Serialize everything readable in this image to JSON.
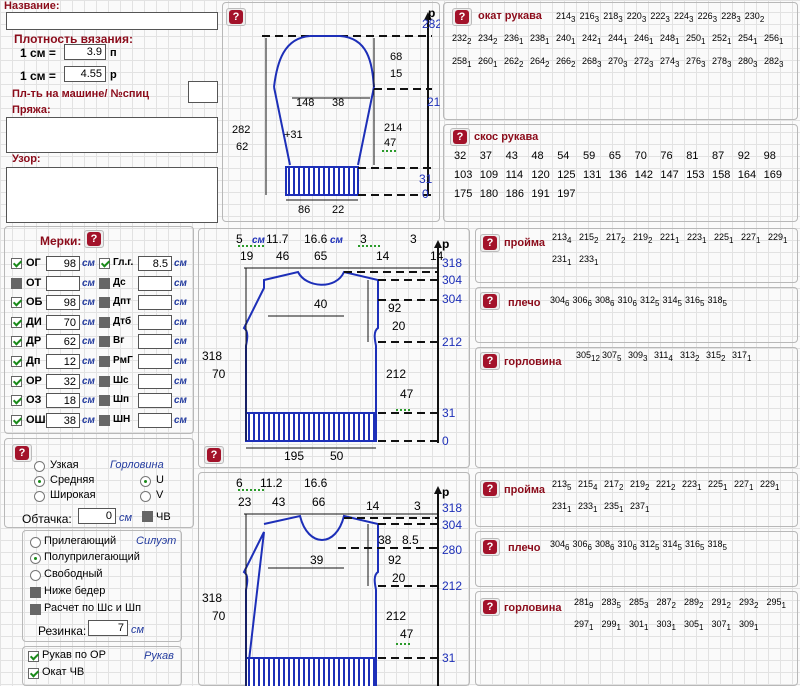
{
  "header": {
    "name_label": "Название:",
    "density_label": "Плотность вязания:",
    "cm1_label": "1 см =",
    "density_p": {
      "value": "3.9",
      "unit": "п"
    },
    "density_r": {
      "value": "4.55",
      "unit": "р"
    },
    "machine_label": "Пл-ть на машине/ №спиц",
    "yarn_label": "Пряжа:",
    "pattern_label": "Узор:"
  },
  "sleeve_diagram": {
    "top_rows": "282",
    "p": "р",
    "label_148": "148",
    "label_38": "38",
    "label_68": "68",
    "label_15": "15",
    "label_214": "214",
    "label_282": "282",
    "label_62": "62",
    "label_31": "+31",
    "label_214b": "214",
    "label_47": "47",
    "label_31b": "31",
    "label_0": "0",
    "label_86": "86",
    "label_22": "22",
    "u_p": "п",
    "u_r": "р",
    "u_cm": "см"
  },
  "okat": {
    "title": "окат рукава",
    "rows": [
      [
        [
          "214",
          "3"
        ],
        [
          "216",
          "3"
        ],
        [
          "218",
          "3"
        ],
        [
          "220",
          "3"
        ],
        [
          "222",
          "3"
        ],
        [
          "224",
          "3"
        ],
        [
          "226",
          "3"
        ],
        [
          "228",
          "3"
        ],
        [
          "230",
          "2"
        ]
      ],
      [
        [
          "232",
          "2"
        ],
        [
          "234",
          "2"
        ],
        [
          "236",
          "1"
        ],
        [
          "238",
          "1"
        ],
        [
          "240",
          "1"
        ],
        [
          "242",
          "1"
        ],
        [
          "244",
          "1"
        ],
        [
          "246",
          "1"
        ],
        [
          "248",
          "1"
        ],
        [
          "250",
          "1"
        ],
        [
          "252",
          "1"
        ],
        [
          "254",
          "1"
        ],
        [
          "256",
          "1"
        ]
      ],
      [
        [
          "258",
          "1"
        ],
        [
          "260",
          "1"
        ],
        [
          "262",
          "2"
        ],
        [
          "264",
          "2"
        ],
        [
          "266",
          "2"
        ],
        [
          "268",
          "3"
        ],
        [
          "270",
          "3"
        ],
        [
          "272",
          "3"
        ],
        [
          "274",
          "3"
        ],
        [
          "276",
          "3"
        ],
        [
          "278",
          "3"
        ],
        [
          "280",
          "3"
        ],
        [
          "282",
          "3"
        ]
      ]
    ]
  },
  "skos": {
    "title": "скос рукава",
    "rows": [
      [
        "32",
        "37",
        "43",
        "48",
        "54",
        "59",
        "65",
        "70",
        "76",
        "81",
        "87",
        "92",
        "98"
      ],
      [
        "103",
        "109",
        "114",
        "120",
        "125",
        "131",
        "136",
        "142",
        "147",
        "153",
        "158",
        "164",
        "169"
      ],
      [
        "175",
        "180",
        "186",
        "191",
        "197"
      ]
    ]
  },
  "merki": {
    "title": "Мерки:",
    "left": [
      {
        "code": "ОГ",
        "value": "98",
        "on": true
      },
      {
        "code": "ОТ",
        "value": "",
        "on": false
      },
      {
        "code": "ОБ",
        "value": "98",
        "on": true
      },
      {
        "code": "ДИ",
        "value": "70",
        "on": true
      },
      {
        "code": "ДР",
        "value": "62",
        "on": true
      },
      {
        "code": "Дп",
        "value": "12",
        "on": true
      },
      {
        "code": "ОР",
        "value": "32",
        "on": true
      },
      {
        "code": "ОЗ",
        "value": "18",
        "on": true
      },
      {
        "code": "ОШ",
        "value": "38",
        "on": true
      }
    ],
    "right": [
      {
        "code": "Гл.г.",
        "value": "8.5",
        "on": true
      },
      {
        "code": "Дс",
        "value": "",
        "on": false
      },
      {
        "code": "Дпт",
        "value": "",
        "on": false
      },
      {
        "code": "Дтб",
        "value": "",
        "on": false
      },
      {
        "code": "Вг",
        "value": "",
        "on": false
      },
      {
        "code": "РмГ",
        "value": "",
        "on": false
      },
      {
        "code": "Шс",
        "value": "",
        "on": false
      },
      {
        "code": "Шп",
        "value": "",
        "on": false
      },
      {
        "code": "ШН",
        "value": "",
        "on": false
      }
    ],
    "unit": "см"
  },
  "neck": {
    "title": "Горловина",
    "options": [
      "Узкая",
      "Средняя",
      "Широкая"
    ],
    "shape_options": [
      "U",
      "V"
    ],
    "obtachka_label": "Обтачка:",
    "obtachka_value": "0",
    "unit": "см",
    "chv_label": "ЧВ"
  },
  "silhouette": {
    "title": "Силуэт",
    "options": [
      "Прилегающий",
      "Полуприлегающий",
      "Свободный"
    ],
    "checks": [
      "Ниже бедер",
      "Расчет по Шс и Шп"
    ],
    "rezinka_label": "Резинка:",
    "rezinka_value": "7",
    "unit": "см"
  },
  "sleeve_opts": {
    "title": "Рукав",
    "checks": [
      "Рукав по ОР",
      "Окат ЧВ"
    ]
  },
  "back_diagram": {
    "top_cm": [
      "5",
      "11.7",
      "16.6",
      "3",
      "3"
    ],
    "top_p": [
      "19",
      "46",
      "65",
      "14",
      "14"
    ],
    "rows_r": [
      "318",
      "304",
      "304",
      "212",
      "31",
      "0"
    ],
    "w40": "40",
    "l318": "318",
    "l70": "70",
    "l92": "92",
    "l20": "20",
    "l212": "212",
    "l47": "47",
    "l195": "195",
    "l50": "50",
    "u_p": "п",
    "u_r": "р",
    "u_cm": "см"
  },
  "front_diagram": {
    "top_cm": [
      "6",
      "11.2",
      "16.6",
      "3"
    ],
    "top_p": [
      "23",
      "43",
      "66",
      "14"
    ],
    "rows_r": [
      "318",
      "304",
      "280",
      "212",
      "31"
    ],
    "w39": "39",
    "l318": "318",
    "l70": "70",
    "l38": "38",
    "l85": "8.5",
    "l92": "92",
    "l20": "20",
    "l212": "212",
    "l47": "47",
    "u_p": "п",
    "u_r": "р",
    "u_cm": "см"
  },
  "back_tables": {
    "proyma": {
      "title": "пройма",
      "vals": [
        [
          "213",
          "4"
        ],
        [
          "215",
          "2"
        ],
        [
          "217",
          "2"
        ],
        [
          "219",
          "2"
        ],
        [
          "221",
          "1"
        ],
        [
          "223",
          "1"
        ],
        [
          "225",
          "1"
        ],
        [
          "227",
          "1"
        ],
        [
          "229",
          "1"
        ],
        [
          "231",
          "1"
        ],
        [
          "233",
          "1"
        ]
      ]
    },
    "plecho": {
      "title": "плечо",
      "vals": [
        [
          "304",
          "6"
        ],
        [
          "306",
          "6"
        ],
        [
          "308",
          "6"
        ],
        [
          "310",
          "6"
        ],
        [
          "312",
          "5"
        ],
        [
          "314",
          "5"
        ],
        [
          "316",
          "5"
        ],
        [
          "318",
          "5"
        ]
      ]
    },
    "gorlovina": {
      "title": "горловина",
      "vals": [
        [
          "305",
          "12"
        ],
        [
          "307",
          "5"
        ],
        [
          "309",
          "3"
        ],
        [
          "311",
          "4"
        ],
        [
          "313",
          "2"
        ],
        [
          "315",
          "2"
        ],
        [
          "317",
          "1"
        ]
      ]
    }
  },
  "front_tables": {
    "proyma": {
      "title": "пройма",
      "vals": [
        [
          "213",
          "5"
        ],
        [
          "215",
          "4"
        ],
        [
          "217",
          "2"
        ],
        [
          "219",
          "2"
        ],
        [
          "221",
          "2"
        ],
        [
          "223",
          "1"
        ],
        [
          "225",
          "1"
        ],
        [
          "227",
          "1"
        ],
        [
          "229",
          "1"
        ],
        [
          "231",
          "1"
        ],
        [
          "233",
          "1"
        ],
        [
          "235",
          "1"
        ],
        [
          "237",
          "1"
        ]
      ]
    },
    "plecho": {
      "title": "плечо",
      "vals": [
        [
          "304",
          "6"
        ],
        [
          "306",
          "6"
        ],
        [
          "308",
          "6"
        ],
        [
          "310",
          "6"
        ],
        [
          "312",
          "5"
        ],
        [
          "314",
          "5"
        ],
        [
          "316",
          "5"
        ],
        [
          "318",
          "5"
        ]
      ]
    },
    "gorlovina": {
      "title": "горловина",
      "vals": [
        [
          "281",
          "9"
        ],
        [
          "283",
          "5"
        ],
        [
          "285",
          "3"
        ],
        [
          "287",
          "2"
        ],
        [
          "289",
          "2"
        ],
        [
          "291",
          "2"
        ],
        [
          "293",
          "2"
        ],
        [
          "295",
          "1"
        ],
        [
          "297",
          "1"
        ],
        [
          "299",
          "1"
        ],
        [
          "301",
          "1"
        ],
        [
          "303",
          "1"
        ],
        [
          "305",
          "1"
        ],
        [
          "307",
          "1"
        ],
        [
          "309",
          "1"
        ]
      ]
    }
  }
}
